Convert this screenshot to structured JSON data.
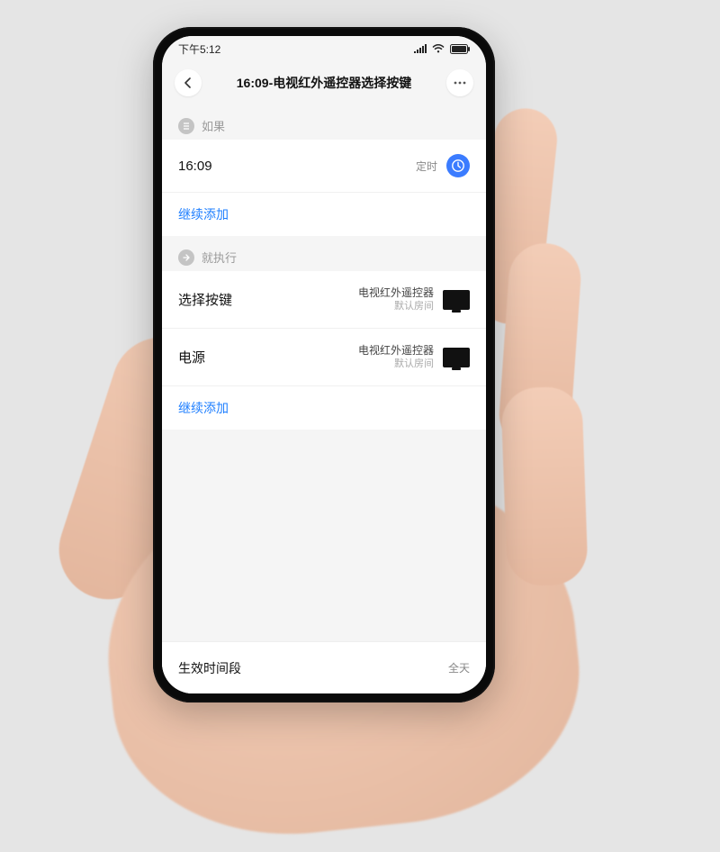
{
  "statusbar": {
    "time": "下午5:12"
  },
  "appbar": {
    "title": "16:09-电视红外遥控器选择按键"
  },
  "if_section": {
    "label": "如果",
    "time_row": {
      "value": "16:09",
      "tag": "定时"
    },
    "add_link": "继续添加"
  },
  "then_section": {
    "label": "就执行",
    "rows": [
      {
        "title": "选择按键",
        "device": "电视红外遥控器",
        "room": "默认房间"
      },
      {
        "title": "电源",
        "device": "电视红外遥控器",
        "room": "默认房间"
      }
    ],
    "add_link": "继续添加"
  },
  "footer": {
    "label": "生效时间段",
    "value": "全天"
  }
}
